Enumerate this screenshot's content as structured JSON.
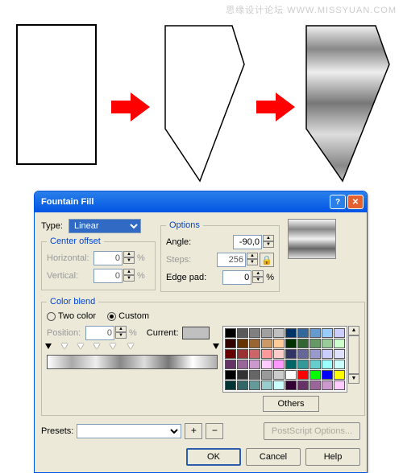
{
  "watermark": "思缘设计论坛  WWW.MISSYUAN.COM",
  "dialog": {
    "title": "Fountain Fill",
    "type_label": "Type:",
    "type_value": "Linear",
    "center_offset": {
      "legend": "Center offset",
      "horizontal_label": "Horizontal:",
      "horizontal_value": "0",
      "vertical_label": "Vertical:",
      "vertical_value": "0",
      "pct": "%"
    },
    "options": {
      "legend": "Options",
      "angle_label": "Angle:",
      "angle_value": "-90,0",
      "steps_label": "Steps:",
      "steps_value": "256",
      "edge_label": "Edge pad:",
      "edge_value": "0",
      "pct": "%"
    },
    "color_blend": {
      "legend": "Color blend",
      "two_color": "Two color",
      "custom": "Custom",
      "position_label": "Position:",
      "position_value": "0",
      "pct": "%",
      "current_label": "Current:"
    },
    "others_btn": "Others",
    "presets_label": "Presets:",
    "postscript_btn": "PostScript Options...",
    "ok": "OK",
    "cancel": "Cancel",
    "help": "Help"
  },
  "palette_colors": [
    "#000000",
    "#5a5a5a",
    "#808080",
    "#a0a0a0",
    "#c0c0c0",
    "#003366",
    "#336699",
    "#6699cc",
    "#99ccff",
    "#ccccff",
    "#330000",
    "#663300",
    "#996633",
    "#cc9966",
    "#ffcc99",
    "#003300",
    "#336633",
    "#669966",
    "#99cc99",
    "#ccffcc",
    "#660000",
    "#993333",
    "#cc6666",
    "#ff9999",
    "#ffcccc",
    "#333366",
    "#666699",
    "#9999cc",
    "#ccccff",
    "#e0e0ff",
    "#663366",
    "#996699",
    "#cc99cc",
    "#ffccff",
    "#ff99ff",
    "#006666",
    "#339999",
    "#66cccc",
    "#99ffff",
    "#ccffff",
    "#000000",
    "#333333",
    "#666666",
    "#999999",
    "#cccccc",
    "#ffffff",
    "#ff0000",
    "#00ff00",
    "#0000ff",
    "#ffff00",
    "#003333",
    "#336666",
    "#669999",
    "#99cccc",
    "#ccffff",
    "#330033",
    "#663366",
    "#996699",
    "#cc99cc",
    "#ffccff"
  ]
}
